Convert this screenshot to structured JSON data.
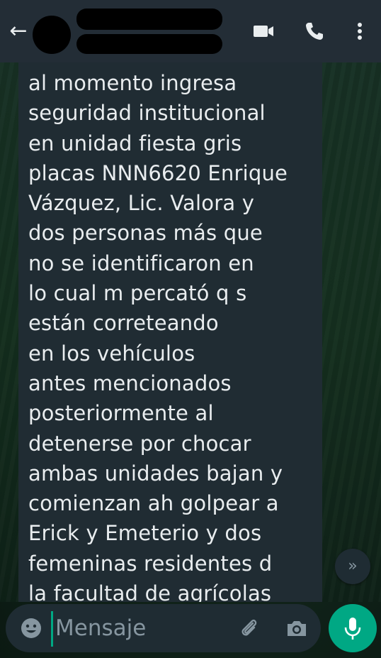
{
  "header": {
    "back_icon": "arrow-left-icon",
    "video_icon": "video-camera-icon",
    "call_icon": "phone-icon",
    "menu_icon": "more-vertical-icon"
  },
  "message": {
    "lines": [
      "al momento ingresa",
      "seguridad institucional",
      "en unidad fiesta gris",
      "placas NNN6620 Enrique",
      "Vázquez, Lic. Valora y",
      "dos personas más que",
      "no se identificaron  en",
      "lo cual m percató q s",
      "están correteando",
      "en los vehículos",
      "antes mencionados",
      "posteriormente al",
      "detenerse por chocar",
      "ambas unidades bajan y",
      "comienzan ah golpear a",
      "Erick y Emeterio y dos",
      "femeninas residentes d",
      "la facultad de agrícolas"
    ]
  },
  "scroll_button": {
    "icon": "double-chevron-down-icon"
  },
  "composer": {
    "placeholder": "Mensaje",
    "emoji_icon": "emoji-icon",
    "attach_icon": "paperclip-icon",
    "camera_icon": "camera-icon",
    "mic_icon": "microphone-icon"
  },
  "colors": {
    "header_bg": "#232d36",
    "bubble_bg": "#202c33",
    "accent": "#00a884",
    "text": "#e9edef",
    "muted": "#8696a0"
  }
}
